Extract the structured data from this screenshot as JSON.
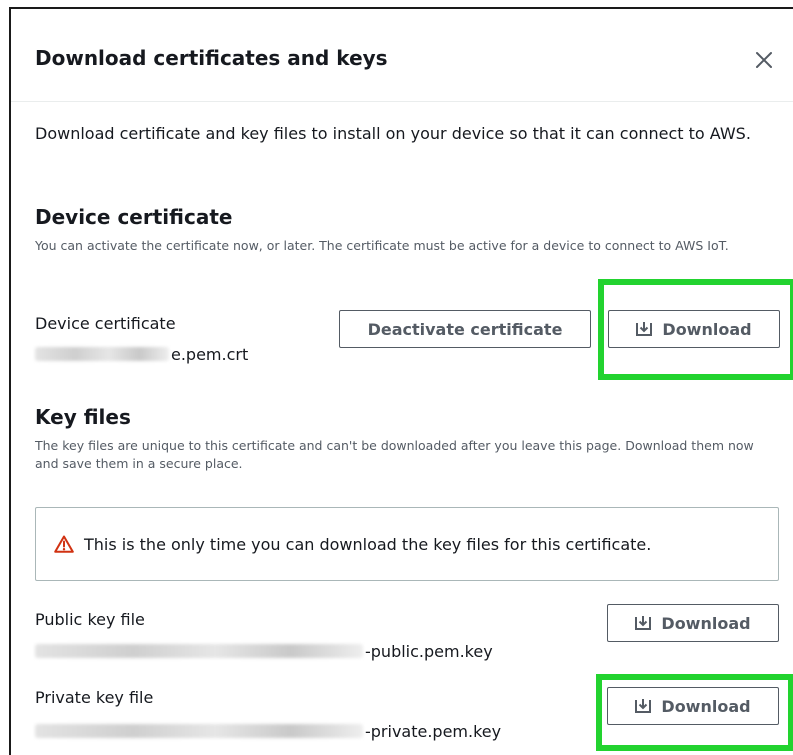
{
  "modal": {
    "title": "Download certificates and keys",
    "close_label": "Close",
    "intro": "Download certificate and key files to install on your device so that it can connect to AWS."
  },
  "device_certificate": {
    "heading": "Device certificate",
    "description": "You can activate the certificate now, or later. The certificate must be active for a device to connect to AWS IoT.",
    "label": "Device certificate",
    "file_suffix": "e.pem.crt",
    "deactivate_label": "Deactivate certificate",
    "download_label": "Download"
  },
  "key_files": {
    "heading": "Key files",
    "description": "The key files are unique to this certificate and can't be downloaded after you leave this page. Download them now and save them in a secure place.",
    "warning": "This is the only time you can download the key files for this certificate.",
    "public_label": "Public key file",
    "public_file_suffix": "-public.pem.key",
    "public_download_label": "Download",
    "private_label": "Private key file",
    "private_file_suffix": "-private.pem.key",
    "private_download_label": "Download"
  },
  "colors": {
    "highlight": "#22d32f",
    "warning_icon": "#d13212",
    "button_text": "#545b64"
  },
  "icons": {
    "close": "close-icon",
    "download": "download-icon",
    "warning": "warning-icon"
  }
}
